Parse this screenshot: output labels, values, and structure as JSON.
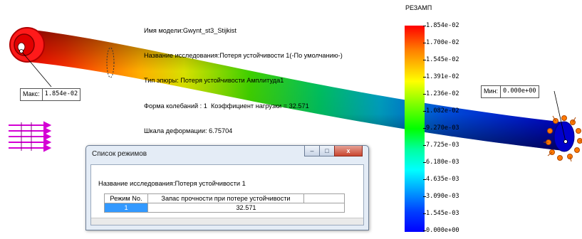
{
  "info": {
    "model": "Имя модели:Gwynt_st3_Stijkist",
    "study": "Название исследования:Потеря устойчивости 1(-По умолчанию-)",
    "plot_type": "Тип эпюры: Потеря устойчивости Амплитуда1",
    "mode_shape": "Форма колебаний : 1  Коэффициент нагрузки = 32.571",
    "deform_scale": "Шкала деформации: 6.75704"
  },
  "legend": {
    "title": "РЕЗАМП",
    "ticks": [
      "1.854e-02",
      "1.700e-02",
      "1.545e-02",
      "1.391e-02",
      "1.236e-02",
      "1.082e-02",
      "9.270e-03",
      "7.725e-03",
      "6.180e-03",
      "4.635e-03",
      "3.090e-03",
      "1.545e-03",
      "0.000e+00"
    ],
    "colors": [
      "#ff0000",
      "#ffff00",
      "#00ff00",
      "#00ffff",
      "#0000ff"
    ]
  },
  "callouts": {
    "max_label": "Макс:",
    "max_value": "1.854e-02",
    "min_label": "Мин:",
    "min_value": "0.000e+00"
  },
  "dialog": {
    "title": "Список режимов",
    "study_label": "Название исследования:Потеря устойчивости 1",
    "columns": [
      "Режим No.",
      "Запас прочности при потере устойчивости"
    ],
    "rows": [
      {
        "mode": "1",
        "factor": "32.571"
      }
    ],
    "buttons": {
      "minimize": "–",
      "maximize": "□",
      "close": "x"
    }
  },
  "icons": {
    "load_arrows": "load-arrows-icon",
    "fixture": "fixed-geometry-icon"
  }
}
